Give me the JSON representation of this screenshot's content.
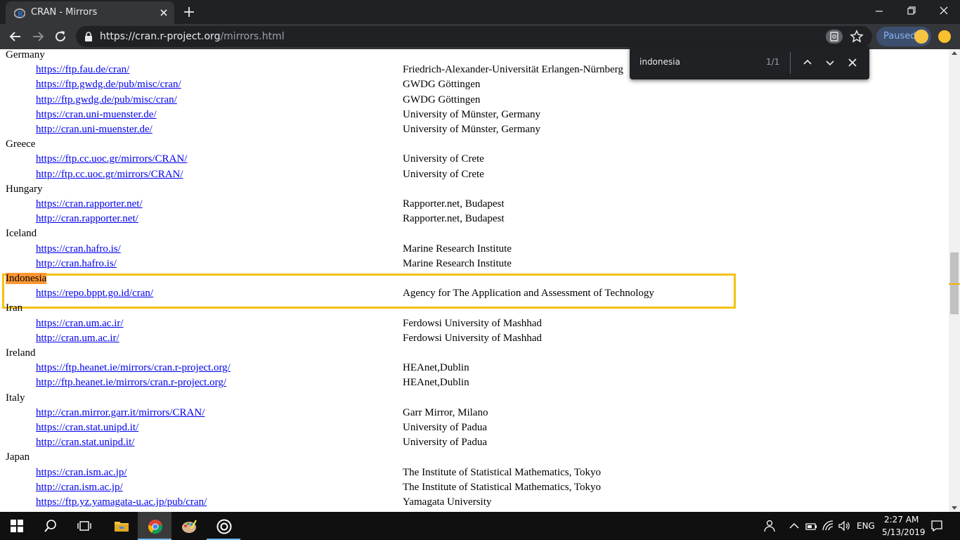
{
  "browser": {
    "tab_title": "CRAN - Mirrors",
    "url_host": "https://cran.r-project.org",
    "url_path": "/mirrors.html",
    "profile_status": "Paused"
  },
  "find_bar": {
    "query": "indonesia",
    "count": "1/1"
  },
  "mirrors": [
    {
      "country": "Germany",
      "entries": [
        {
          "url": "https://ftp.fau.de/cran/",
          "desc": "Friedrich-Alexander-Universität Erlangen-Nürnberg"
        },
        {
          "url": "https://ftp.gwdg.de/pub/misc/cran/",
          "desc": "GWDG Göttingen"
        },
        {
          "url": "http://ftp.gwdg.de/pub/misc/cran/",
          "desc": "GWDG Göttingen"
        },
        {
          "url": "https://cran.uni-muenster.de/",
          "desc": "University of Münster, Germany"
        },
        {
          "url": "http://cran.uni-muenster.de/",
          "desc": "University of Münster, Germany"
        }
      ]
    },
    {
      "country": "Greece",
      "entries": [
        {
          "url": "https://ftp.cc.uoc.gr/mirrors/CRAN/",
          "desc": "University of Crete"
        },
        {
          "url": "http://ftp.cc.uoc.gr/mirrors/CRAN/",
          "desc": "University of Crete"
        }
      ]
    },
    {
      "country": "Hungary",
      "entries": [
        {
          "url": "https://cran.rapporter.net/",
          "desc": "Rapporter.net, Budapest"
        },
        {
          "url": "http://cran.rapporter.net/",
          "desc": "Rapporter.net, Budapest"
        }
      ]
    },
    {
      "country": "Iceland",
      "entries": [
        {
          "url": "https://cran.hafro.is/",
          "desc": "Marine Research Institute"
        },
        {
          "url": "http://cran.hafro.is/",
          "desc": "Marine Research Institute"
        }
      ]
    },
    {
      "country": "Indonesia",
      "entries": [
        {
          "url": "https://repo.bppt.go.id/cran/",
          "desc": "Agency for The Application and Assessment of Technology"
        }
      ]
    },
    {
      "country": "Iran",
      "entries": [
        {
          "url": "https://cran.um.ac.ir/",
          "desc": "Ferdowsi University of Mashhad"
        },
        {
          "url": "http://cran.um.ac.ir/",
          "desc": "Ferdowsi University of Mashhad"
        }
      ]
    },
    {
      "country": "Ireland",
      "entries": [
        {
          "url": "https://ftp.heanet.ie/mirrors/cran.r-project.org/",
          "desc": "HEAnet,Dublin"
        },
        {
          "url": "http://ftp.heanet.ie/mirrors/cran.r-project.org/",
          "desc": "HEAnet,Dublin"
        }
      ]
    },
    {
      "country": "Italy",
      "entries": [
        {
          "url": "http://cran.mirror.garr.it/mirrors/CRAN/",
          "desc": "Garr Mirror, Milano"
        },
        {
          "url": "https://cran.stat.unipd.it/",
          "desc": "University of Padua"
        },
        {
          "url": "http://cran.stat.unipd.it/",
          "desc": "University of Padua"
        }
      ]
    },
    {
      "country": "Japan",
      "entries": [
        {
          "url": "https://cran.ism.ac.jp/",
          "desc": "The Institute of Statistical Mathematics, Tokyo"
        },
        {
          "url": "http://cran.ism.ac.jp/",
          "desc": "The Institute of Statistical Mathematics, Tokyo"
        },
        {
          "url": "https://ftp.yz.yamagata-u.ac.jp/pub/cran/",
          "desc": "Yamagata University"
        }
      ]
    }
  ],
  "highlighted_country_index": 4,
  "taskbar": {
    "language": "ENG",
    "time": "2:27 AM",
    "date": "5/13/2019"
  },
  "colors": {
    "link": "#0000ee",
    "find_highlight": "#ff9632",
    "focus_box": "#f4c20d",
    "chrome_dark": "#35363a"
  },
  "icons": [
    "chrome-favicon-r",
    "close-icon",
    "plus-icon",
    "minimize-icon",
    "restore-icon",
    "back-arrow-icon",
    "forward-arrow-icon",
    "reload-icon",
    "lock-icon",
    "find-in-page-icon",
    "star-icon",
    "windows-start-icon",
    "search-icon",
    "task-view-icon",
    "file-explorer-icon",
    "chrome-icon",
    "paint-icon",
    "target-app-icon"
  ]
}
